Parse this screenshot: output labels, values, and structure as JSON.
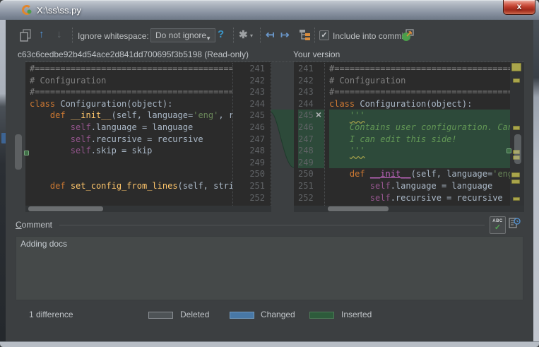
{
  "window": {
    "title": "X:\\ss\\ss.py"
  },
  "icons": {
    "up": "↑",
    "down": "↓",
    "help": "?",
    "gear": "✱",
    "caret_down": "▾",
    "apply_left": "↤",
    "apply_right": "↦",
    "dropdown_caret": "▼",
    "checkbox_check": "✓",
    "close": "x",
    "revert_cross": "×",
    "spell_abc": "ABC",
    "spell_check": "✓"
  },
  "toolbar": {
    "ignore_whitespace_label": "Ignore whitespace:",
    "ignore_whitespace_value": "Do not ignore",
    "include_into_commit_label": "Include into commit"
  },
  "headers": {
    "left": "c63c6cedbe92b4d54ace2d841dd700695f3b5198 (Read-only)",
    "right": "Your version"
  },
  "left_editor": {
    "lines": [
      {
        "num": "241",
        "tokens": [
          [
            "cm",
            "#==========================================================="
          ]
        ]
      },
      {
        "num": "242",
        "tokens": [
          [
            "cm",
            "# Configuration"
          ]
        ]
      },
      {
        "num": "243",
        "tokens": [
          [
            "cm",
            "#==========================================================="
          ]
        ]
      },
      {
        "num": "244",
        "tokens": [
          [
            "kw",
            "class"
          ],
          [
            "pl",
            " Configuration(object):"
          ]
        ]
      },
      {
        "num": "245",
        "tokens": [
          [
            "pl",
            "    "
          ],
          [
            "kw",
            "def"
          ],
          [
            "pl",
            " "
          ],
          [
            "fn",
            "__init__"
          ],
          [
            "pl",
            "(self, language="
          ],
          [
            "str",
            "'eng'"
          ],
          [
            "pl",
            ", re"
          ]
        ]
      },
      {
        "num": "246",
        "tokens": [
          [
            "pl",
            "        "
          ],
          [
            "self",
            "self"
          ],
          [
            "pl",
            ".language = language"
          ]
        ]
      },
      {
        "num": "247",
        "tokens": [
          [
            "pl",
            "        "
          ],
          [
            "self",
            "self"
          ],
          [
            "pl",
            ".recursive = recursive"
          ]
        ]
      },
      {
        "num": "248",
        "tokens": [
          [
            "pl",
            "        "
          ],
          [
            "self",
            "self"
          ],
          [
            "pl",
            ".skip = skip"
          ]
        ]
      },
      {
        "num": "249",
        "tokens": []
      },
      {
        "num": "250",
        "tokens": []
      },
      {
        "num": "251",
        "tokens": [
          [
            "pl",
            "    "
          ],
          [
            "kw",
            "def"
          ],
          [
            "pl",
            " "
          ],
          [
            "fn",
            "set_config_from_lines"
          ],
          [
            "pl",
            "(self, stri"
          ]
        ]
      },
      {
        "num": "252",
        "tokens": []
      }
    ]
  },
  "right_editor": {
    "lines": [
      {
        "num": "241",
        "tokens": [
          [
            "cm",
            "#==========================================================="
          ]
        ]
      },
      {
        "num": "242",
        "tokens": [
          [
            "cm",
            "# Configuration"
          ]
        ]
      },
      {
        "num": "243",
        "tokens": [
          [
            "cm",
            "#==========================================================="
          ]
        ]
      },
      {
        "num": "244",
        "tokens": [
          [
            "kw",
            "class"
          ],
          [
            "pl",
            " Configuration(object):"
          ]
        ]
      },
      {
        "num": "245",
        "ins": true,
        "tokens": [
          [
            "pl",
            "    "
          ],
          [
            "docq",
            "'''"
          ]
        ]
      },
      {
        "num": "246",
        "ins": true,
        "tokens": [
          [
            "pl",
            "    "
          ],
          [
            "doc",
            "Contains user configuration. Can"
          ]
        ]
      },
      {
        "num": "247",
        "ins": true,
        "tokens": [
          [
            "pl",
            "    "
          ],
          [
            "doc",
            "I can edit this side!"
          ]
        ]
      },
      {
        "num": "248",
        "ins": true,
        "tokens": [
          [
            "pl",
            "    "
          ],
          [
            "docq",
            "'''"
          ]
        ]
      },
      {
        "num": "249",
        "ins": true,
        "tokens": []
      },
      {
        "num": "250",
        "tokens": [
          [
            "pl",
            "    "
          ],
          [
            "kw",
            "def"
          ],
          [
            "pl",
            " "
          ],
          [
            "magic",
            "__init__"
          ],
          [
            "pl",
            "(self, language="
          ],
          [
            "str",
            "'eng"
          ]
        ]
      },
      {
        "num": "251",
        "tokens": [
          [
            "pl",
            "        "
          ],
          [
            "self",
            "self"
          ],
          [
            "pl",
            ".language = language"
          ]
        ]
      },
      {
        "num": "252",
        "tokens": [
          [
            "pl",
            "        "
          ],
          [
            "self",
            "self"
          ],
          [
            "pl",
            ".recursive = recursive"
          ]
        ]
      }
    ]
  },
  "comment": {
    "label": "Comment",
    "text": "Adding docs"
  },
  "legend": {
    "status": "1 difference",
    "items": [
      {
        "label": "Deleted",
        "color": "#4e5356",
        "border": "#8a8f93"
      },
      {
        "label": "Changed",
        "color": "#4878a6",
        "border": "#739cc1"
      },
      {
        "label": "Inserted",
        "color": "#2d5b3b",
        "border": "#4c7a57"
      }
    ]
  },
  "colors": {
    "keyword": "#cc7832",
    "comment": "#808080",
    "string": "#6a8759",
    "docstring": "#629755",
    "self_ref": "#94558d",
    "function_name": "#ffc66b",
    "magic_method": "#bf65bf",
    "plain": "#a9b7c6",
    "inserted_bg": "#2d4a3a",
    "warning": "#a9a54b",
    "editor_bg": "#2b2b2b",
    "panel_bg": "#3c3f41",
    "line_number": "#606366"
  }
}
